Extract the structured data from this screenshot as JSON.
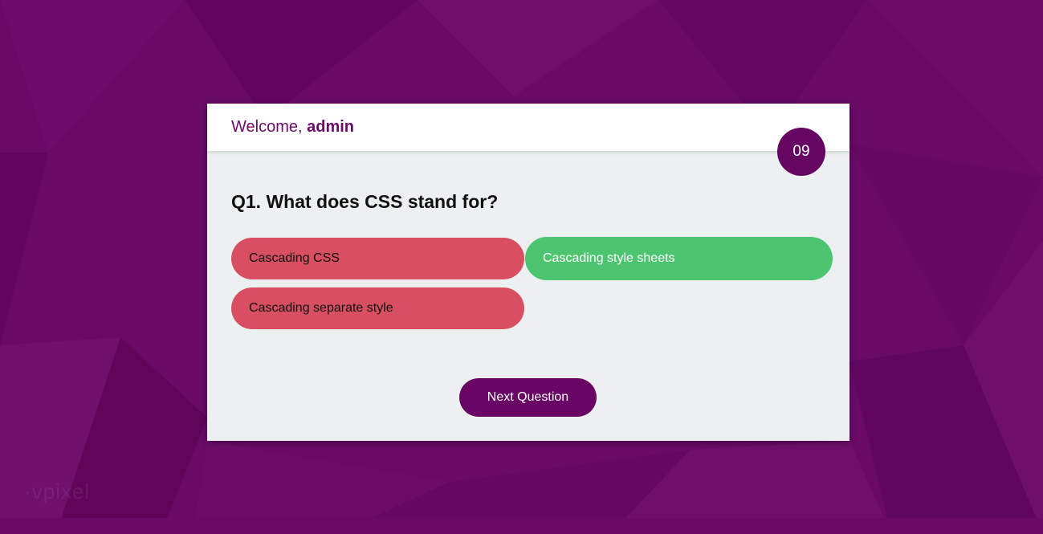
{
  "header": {
    "greeting": "Welcome,",
    "username": "admin"
  },
  "timer": {
    "value": "09"
  },
  "question": {
    "text": "Q1. What does CSS stand for?"
  },
  "options": [
    {
      "label": "Cascading CSS",
      "state": "wrong"
    },
    {
      "label": "Cascading style sheets",
      "state": "correct"
    },
    {
      "label": "Cascading separate style",
      "state": "wrong"
    }
  ],
  "actions": {
    "next_label": "Next Question"
  },
  "colors": {
    "background": "#690a66",
    "card": "#ecf0f1",
    "primary": "#680565",
    "wrong": "#d74f61",
    "correct": "#4dc46f"
  }
}
